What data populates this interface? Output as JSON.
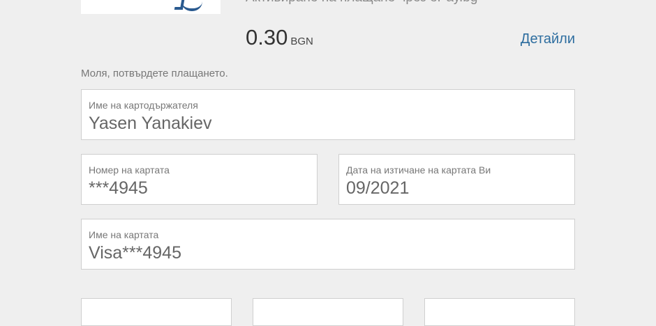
{
  "merchant": {
    "description": "Активиране на плащане чрез ePay.bg",
    "amount": "0.30",
    "currency": "BGN",
    "details_link": "Детайли"
  },
  "instruction": "Моля, потвърдете плащането.",
  "fields": {
    "cardholder": {
      "label": "Име на картодържателя",
      "value": "Yasen Yanakiev"
    },
    "card_number": {
      "label": "Номер на картата",
      "value": "***4945"
    },
    "expiry": {
      "label": "Дата на изтичане на картата Ви",
      "value": "09/2021"
    },
    "card_name": {
      "label": "Име на картата",
      "value": "Visa***4945"
    }
  },
  "icons": {
    "logo": "epay-logo"
  },
  "colors": {
    "background": "#efefef",
    "link": "#2d6d9f",
    "field_border": "#cfcfcf"
  }
}
